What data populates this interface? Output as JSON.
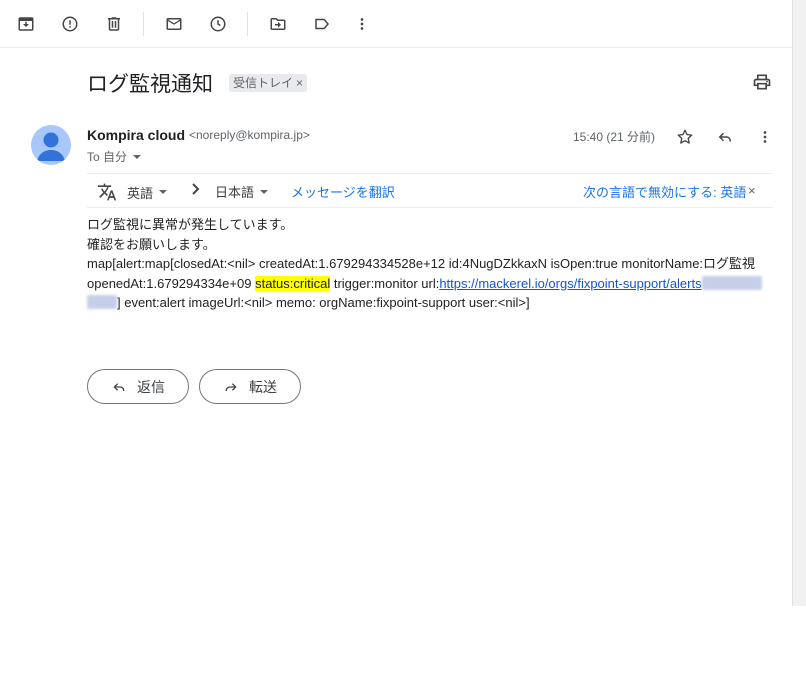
{
  "toolbar": {
    "icons": [
      "archive-icon",
      "report-spam-icon",
      "delete-icon",
      "mark-unread-icon",
      "snooze-icon",
      "move-to-icon",
      "label-icon",
      "more-vert-icon"
    ]
  },
  "email": {
    "subject": "ログ監視通知",
    "label_chip": "受信トレイ",
    "label_chip_close": "×",
    "sender_name": "Kompira cloud",
    "sender_email": "<noreply@kompira.jp>",
    "to_label": "To 自分",
    "time": "15:40 (21 分前)"
  },
  "translate": {
    "source_lang": "英語",
    "target_lang": "日本語",
    "translate_link": "メッセージを翻訳",
    "disable_link": "次の言語で無効にする: 英語",
    "close": "×"
  },
  "body": {
    "line1": "ログ監視に異常が発生しています。",
    "line2": "確認をお願いします。",
    "line3": "map[alert:map[closedAt:<nil> createdAt:1.679294334528e+12 id:4NugDZkkaxN isOpen:true monitorName:ログ監視",
    "line4_pre": "openedAt:1.679294334e+09 ",
    "line4_highlight": "status:critical",
    "line4_mid": " trigger:monitor url:",
    "link_text": "https://mackerel.io/orgs/fixpoint-support/alerts",
    "line5_post": "] event:alert imageUrl:<nil> memo: orgName:fixpoint-support user:<nil>]"
  },
  "actions": {
    "reply": "返信",
    "forward": "転送"
  },
  "colors": {
    "highlight": "#ffff00",
    "link": "#1155cc",
    "accent": "#1a73e8",
    "avatar": "#a8c7fa"
  }
}
